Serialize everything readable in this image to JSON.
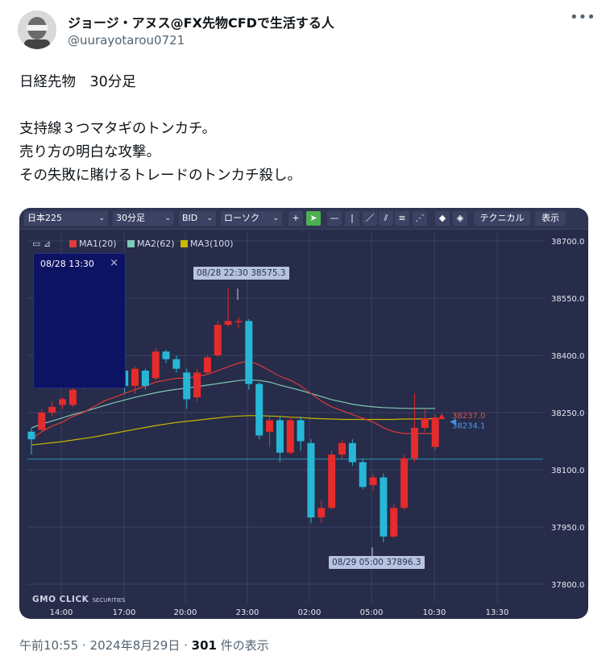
{
  "post": {
    "author_name": "ジョージ・アヌス@FX先物CFDで生活する人",
    "author_handle": "@uurayotarou0721",
    "text": "日経先物　30分足\n\n支持線３つマタギのトンカチ。\n売り方の明白な攻撃。\nその失敗に賭けるトレードのトンカチ殺し。",
    "time": "午前10:55",
    "date": "2024年8月29日",
    "views_count": "301",
    "views_label": "件の表示",
    "separator": " · "
  },
  "icons": {
    "more": "more-horizontal-icon",
    "avatar": "avatar"
  },
  "chart_ui": {
    "symbol": "日本225",
    "timeframe": "30分足",
    "price_type": "BID",
    "chart_type": "ローソク",
    "technical_button": "テクニカル",
    "display_button": "表示",
    "popup_title": "08/28 13:30",
    "popup_close": "×",
    "logo_main": "GMO CLICK",
    "logo_sub": "SECURITIES",
    "tooltip_high": "08/28 22:30 38575.3",
    "tooltip_low": "08/29 05:00 37896.3",
    "price_label_red": "38237.0",
    "price_label_blue": "38234.1"
  },
  "chart_data": {
    "type": "candlestick",
    "x_tick_labels": [
      "14:00",
      "17:00",
      "20:00",
      "23:00",
      "02:00",
      "05:00",
      "10:30",
      "13:30"
    ],
    "y_tick_labels": [
      "38700.0",
      "38550.0",
      "38400.0",
      "38250.0",
      "38100.0",
      "37950.0",
      "37800.0"
    ],
    "ylim": [
      37780,
      38720
    ],
    "grid": true,
    "legend": [
      {
        "name": "MA1(20)",
        "color": "#e03a3a"
      },
      {
        "name": "MA2(62)",
        "color": "#7fc9b5"
      },
      {
        "name": "MA3(100)",
        "color": "#c9b800"
      }
    ],
    "candles": [
      [
        38200,
        38210,
        38140,
        38180
      ],
      [
        38205,
        38260,
        38200,
        38250
      ],
      [
        38250,
        38280,
        38240,
        38265
      ],
      [
        38270,
        38290,
        38260,
        38285
      ],
      [
        38270,
        38350,
        38265,
        38310
      ],
      [
        38320,
        38380,
        38310,
        38370
      ],
      [
        38380,
        38395,
        38340,
        38360
      ],
      [
        38360,
        38420,
        38355,
        38415
      ],
      [
        38410,
        38420,
        38350,
        38355
      ],
      [
        38360,
        38370,
        38300,
        38320
      ],
      [
        38320,
        38370,
        38300,
        38365
      ],
      [
        38360,
        38365,
        38310,
        38320
      ],
      [
        38340,
        38420,
        38335,
        38410
      ],
      [
        38410,
        38415,
        38380,
        38390
      ],
      [
        38390,
        38400,
        38355,
        38365
      ],
      [
        38355,
        38365,
        38260,
        38285
      ],
      [
        38290,
        38365,
        38280,
        38355
      ],
      [
        38355,
        38400,
        38350,
        38395
      ],
      [
        38400,
        38490,
        38395,
        38480
      ],
      [
        38480,
        38575,
        38475,
        38490
      ],
      [
        38490,
        38500,
        38470,
        38490
      ],
      [
        38490,
        38495,
        38310,
        38325
      ],
      [
        38325,
        38330,
        38180,
        38190
      ],
      [
        38200,
        38240,
        38160,
        38230
      ],
      [
        38230,
        38240,
        38120,
        38145
      ],
      [
        38145,
        38240,
        38140,
        38230
      ],
      [
        38230,
        38240,
        38150,
        38175
      ],
      [
        38170,
        38180,
        37960,
        37975
      ],
      [
        37975,
        38020,
        37960,
        38000
      ],
      [
        38000,
        38150,
        37995,
        38140
      ],
      [
        38140,
        38180,
        38130,
        38170
      ],
      [
        38170,
        38180,
        38110,
        38120
      ],
      [
        38120,
        38130,
        38050,
        38055
      ],
      [
        38060,
        38090,
        38045,
        38080
      ],
      [
        38080,
        38090,
        37910,
        37925
      ],
      [
        37925,
        38010,
        37920,
        38000
      ],
      [
        38000,
        38140,
        37995,
        38130
      ],
      [
        38130,
        38300,
        38120,
        38210
      ],
      [
        38210,
        38260,
        38200,
        38235
      ],
      [
        38160,
        38245,
        38150,
        38237
      ]
    ],
    "ma1": [
      38180,
      38200,
      38215,
      38225,
      38240,
      38250,
      38265,
      38280,
      38290,
      38300,
      38310,
      38320,
      38330,
      38335,
      38340,
      38340,
      38345,
      38350,
      38360,
      38370,
      38380,
      38385,
      38375,
      38360,
      38345,
      38335,
      38320,
      38300,
      38280,
      38265,
      38255,
      38245,
      38235,
      38225,
      38210,
      38200,
      38195,
      38195,
      38195,
      38195
    ],
    "ma2": [
      38210,
      38220,
      38228,
      38236,
      38245,
      38252,
      38260,
      38268,
      38276,
      38283,
      38290,
      38296,
      38302,
      38307,
      38311,
      38314,
      38318,
      38322,
      38326,
      38330,
      38334,
      38336,
      38334,
      38330,
      38322,
      38315,
      38308,
      38300,
      38292,
      38284,
      38278,
      38272,
      38268,
      38265,
      38263,
      38262,
      38261,
      38261,
      38261,
      38261
    ],
    "ma3": [
      38165,
      38168,
      38171,
      38174,
      38178,
      38182,
      38186,
      38191,
      38196,
      38201,
      38206,
      38211,
      38216,
      38220,
      38224,
      38227,
      38230,
      38233,
      38236,
      38239,
      38241,
      38242,
      38242,
      38241,
      38240,
      38238,
      38237,
      38235,
      38234,
      38233,
      38232,
      38232,
      38232,
      38232,
      38232,
      38232,
      38233,
      38233,
      38234,
      38234
    ],
    "horizontal_line": 38128,
    "colors": {
      "up": "#e52b2b",
      "down": "#27b7d6",
      "background": "#262c49",
      "grid": "#3a4163",
      "axis_text": "#e8ebf6"
    }
  }
}
